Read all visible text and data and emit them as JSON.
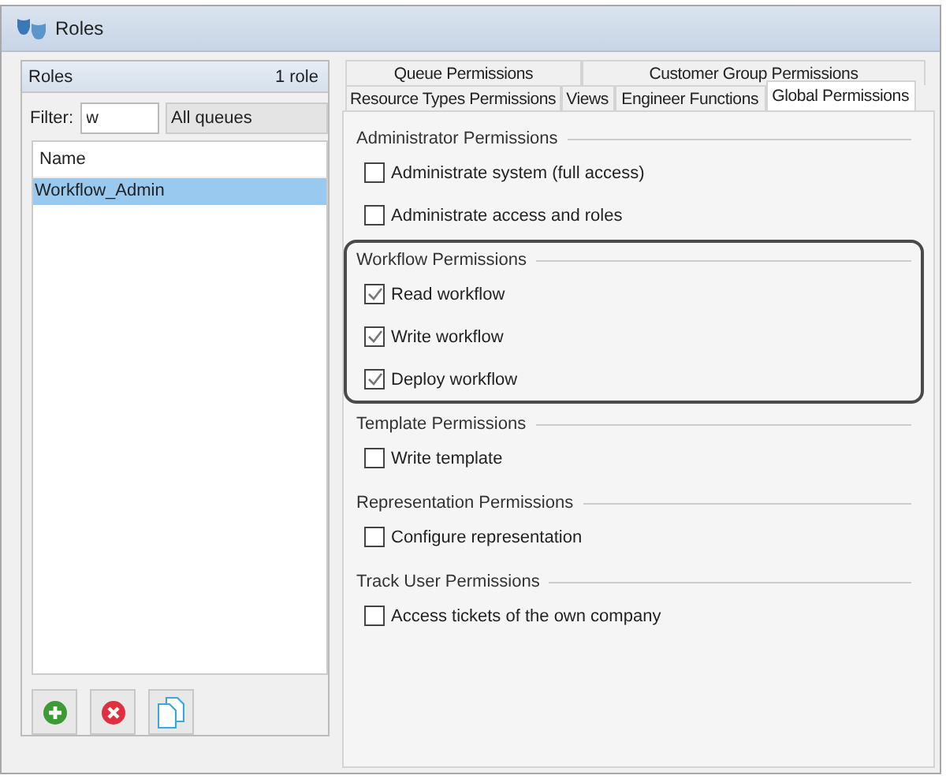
{
  "window": {
    "title": "Roles"
  },
  "roles_panel": {
    "title": "Roles",
    "count": "1 role",
    "filter": {
      "label": "Filter:",
      "value": "w"
    },
    "queue_select": {
      "value": "All queues"
    },
    "list": {
      "column": "Name",
      "rows": [
        {
          "name": "Workflow_Admin",
          "selected": true
        }
      ]
    },
    "buttons": [
      {
        "kind": "add"
      },
      {
        "kind": "delete"
      },
      {
        "kind": "copy"
      }
    ]
  },
  "tab_rows": [
    {
      "tabs": [
        {
          "label": "Queue Permissions",
          "selected": false
        },
        {
          "label": "Customer Group Permissions",
          "selected": false
        }
      ]
    },
    {
      "tabs": [
        {
          "label": "Resource Types Permissions",
          "selected": false
        },
        {
          "label": "Views",
          "selected": false
        },
        {
          "label": "Engineer Functions",
          "selected": false
        },
        {
          "label": "Global Permissions",
          "selected": true
        }
      ]
    }
  ],
  "groups": [
    {
      "title": "Administrator Permissions",
      "highlighted": false,
      "items": [
        {
          "label": "Administrate system (full access)",
          "checked": false
        },
        {
          "label": "Administrate access and roles",
          "checked": false
        }
      ]
    },
    {
      "title": "Workflow Permissions",
      "highlighted": true,
      "items": [
        {
          "label": "Read workflow",
          "checked": true
        },
        {
          "label": "Write workflow",
          "checked": true
        },
        {
          "label": "Deploy workflow",
          "checked": true
        }
      ]
    },
    {
      "title": "Template Permissions",
      "highlighted": false,
      "items": [
        {
          "label": "Write template",
          "checked": false
        }
      ]
    },
    {
      "title": "Representation Permissions",
      "highlighted": false,
      "items": [
        {
          "label": "Configure representation",
          "checked": false
        }
      ]
    },
    {
      "title": "Track User Permissions",
      "highlighted": false,
      "items": [
        {
          "label": "Access tickets of the own company",
          "checked": false
        }
      ]
    }
  ]
}
